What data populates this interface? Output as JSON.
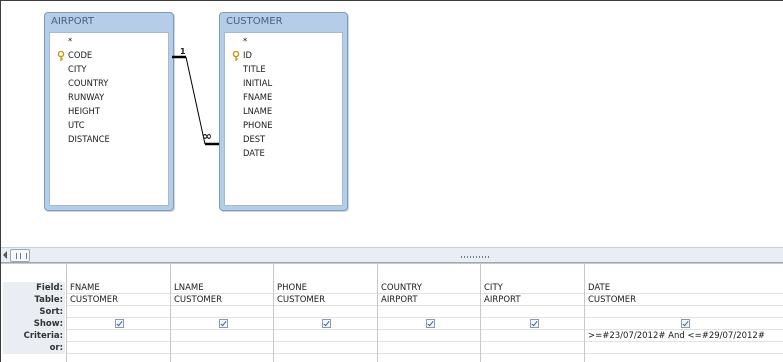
{
  "relationship": {
    "one_label": "1",
    "many_label": "∞"
  },
  "tables": [
    {
      "title": "AIRPORT",
      "star": "*",
      "key_field": "CODE",
      "fields": [
        "CITY",
        "COUNTRY",
        "RUNWAY",
        "HEIGHT",
        "UTC",
        "DISTANCE"
      ]
    },
    {
      "title": "CUSTOMER",
      "star": "*",
      "key_field": "ID",
      "fields": [
        "TITLE",
        "INITIAL",
        "FNAME",
        "LNAME",
        "PHONE",
        "DEST",
        "DATE"
      ]
    }
  ],
  "grid": {
    "row_labels": {
      "field": "Field:",
      "table": "Table:",
      "sort": "Sort:",
      "show": "Show:",
      "criteria": "Criteria:",
      "or": "or:"
    },
    "columns": [
      {
        "field": "FNAME",
        "table": "CUSTOMER",
        "show": true,
        "criteria": ""
      },
      {
        "field": "LNAME",
        "table": "CUSTOMER",
        "show": true,
        "criteria": ""
      },
      {
        "field": "PHONE",
        "table": "CUSTOMER",
        "show": true,
        "criteria": ""
      },
      {
        "field": "COUNTRY",
        "table": "AIRPORT",
        "show": true,
        "criteria": ""
      },
      {
        "field": "CITY",
        "table": "AIRPORT",
        "show": true,
        "criteria": ""
      },
      {
        "field": "DATE",
        "table": "CUSTOMER",
        "show": true,
        "criteria": ">=#23/07/2012# And <=#29/07/2012#"
      }
    ]
  }
}
